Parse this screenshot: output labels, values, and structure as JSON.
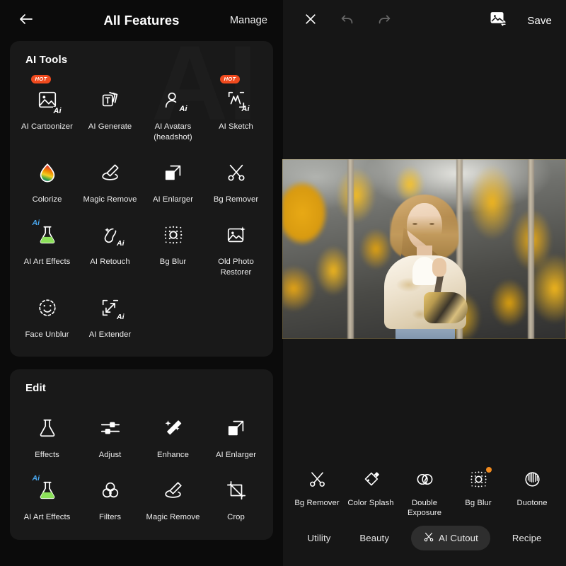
{
  "left_panel": {
    "header": {
      "back_icon": "arrow-left-icon",
      "title": "All Features",
      "manage_label": "Manage"
    },
    "sections": [
      {
        "id": "ai-tools",
        "title": "AI Tools",
        "items": [
          {
            "label": "AI Cartoonizer",
            "icon": "ai-image-icon",
            "badge": "HOT"
          },
          {
            "label": "AI Generate",
            "icon": "text-cards-icon",
            "badge": ""
          },
          {
            "label": "AI Avatars\n(headshot)",
            "icon": "ai-person-icon",
            "badge": ""
          },
          {
            "label": "AI Sketch",
            "icon": "ai-sketch-icon",
            "badge": "HOT"
          },
          {
            "label": "Colorize",
            "icon": "rainbow-droplet-icon",
            "badge": ""
          },
          {
            "label": "Magic Remove",
            "icon": "eraser-pencil-icon",
            "badge": ""
          },
          {
            "label": "AI Enlarger",
            "icon": "expand-square-icon",
            "badge": ""
          },
          {
            "label": "Bg Remover",
            "icon": "scissors-icon",
            "badge": ""
          },
          {
            "label": "AI Art Effects",
            "icon": "ai-flask-icon",
            "badge": ""
          },
          {
            "label": "AI Retouch",
            "icon": "ai-retouch-icon",
            "badge": ""
          },
          {
            "label": "Bg Blur",
            "icon": "bg-blur-icon",
            "badge": ""
          },
          {
            "label": "Old Photo Restorer",
            "icon": "photo-sparkle-icon",
            "badge": ""
          },
          {
            "label": "Face Unblur",
            "icon": "face-unblur-icon",
            "badge": ""
          },
          {
            "label": "AI Extender",
            "icon": "ai-extender-icon",
            "badge": ""
          }
        ]
      },
      {
        "id": "edit",
        "title": "Edit",
        "items": [
          {
            "label": "Effects",
            "icon": "flask-icon",
            "badge": ""
          },
          {
            "label": "Adjust",
            "icon": "sliders-icon",
            "badge": ""
          },
          {
            "label": "Enhance",
            "icon": "magic-wand-icon",
            "badge": ""
          },
          {
            "label": "AI Enlarger",
            "icon": "expand-square-icon",
            "badge": ""
          },
          {
            "label": "AI Art Effects",
            "icon": "ai-flask-icon",
            "badge": ""
          },
          {
            "label": "Filters",
            "icon": "three-circles-icon",
            "badge": ""
          },
          {
            "label": "Magic Remove",
            "icon": "eraser-pencil-icon",
            "badge": ""
          },
          {
            "label": "Crop",
            "icon": "crop-icon",
            "badge": ""
          }
        ]
      }
    ]
  },
  "right_panel": {
    "header": {
      "close_icon": "close-icon",
      "undo_icon": "undo-icon",
      "redo_icon": "redo-icon",
      "compare_icon": "image-compare-icon",
      "save_label": "Save"
    },
    "photo_alt": "woman in white jacket with patterned bag in front of yellow ornamental railing",
    "tools": [
      {
        "label": "Bg Remover",
        "icon": "scissors-icon",
        "badge": ""
      },
      {
        "label": "Color Splash",
        "icon": "paint-bucket-icon",
        "badge": ""
      },
      {
        "label": "Double\nExposure",
        "icon": "double-circles-icon",
        "badge": ""
      },
      {
        "label": "Bg Blur",
        "icon": "bg-blur-icon",
        "badge": "dot"
      },
      {
        "label": "Duotone",
        "icon": "duotone-circle-icon",
        "badge": ""
      }
    ],
    "tabs": [
      {
        "label": "Utility",
        "active": false,
        "icon": ""
      },
      {
        "label": "Beauty",
        "active": false,
        "icon": ""
      },
      {
        "label": "AI Cutout",
        "active": true,
        "icon": "scissors-icon"
      },
      {
        "label": "Recipe",
        "active": false,
        "icon": ""
      }
    ]
  },
  "colors": {
    "page_bg": "#0b0b0b",
    "card_bg": "#191919",
    "right_bg": "#161616",
    "hot_badge": "#f04a1e",
    "dot_badge": "#f08a1e",
    "active_tab_bg": "#2e2e2e",
    "text": "#ffffff"
  }
}
